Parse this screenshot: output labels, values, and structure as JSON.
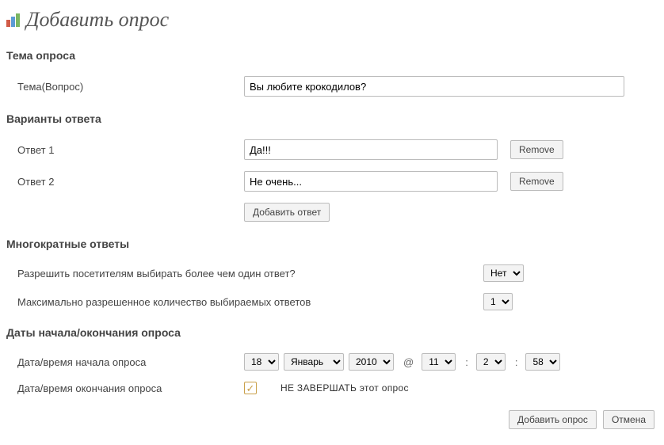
{
  "title": "Добавить опрос",
  "sections": {
    "topic": {
      "heading": "Тема опроса",
      "label": "Тема(Вопрос)",
      "value": "Вы любите крокодилов?"
    },
    "answers": {
      "heading": "Варианты ответа",
      "items": [
        {
          "label": "Ответ 1",
          "value": "Да!!!",
          "remove": "Remove"
        },
        {
          "label": "Ответ 2",
          "value": "Не очень...",
          "remove": "Remove"
        }
      ],
      "add_label": "Добавить ответ"
    },
    "multiple": {
      "heading": "Многократные ответы",
      "allow_label": "Разрешить посетителям выбирать более чем один ответ?",
      "allow_value": "Нет",
      "max_label": "Максимально разрешенное количество выбираемых ответов",
      "max_value": "1"
    },
    "dates": {
      "heading": "Даты начала/окончания опроса",
      "start_label": "Дата/время начала опроса",
      "end_label": "Дата/время окончания опроса",
      "day": "18",
      "month": "Январь",
      "year": "2010",
      "at": "@",
      "hour": "11",
      "minute": "2",
      "second": "58",
      "no_end_label": "НЕ ЗАВЕРШАТЬ этот опрос"
    }
  },
  "footer": {
    "submit": "Добавить опрос",
    "cancel": "Отмена"
  }
}
